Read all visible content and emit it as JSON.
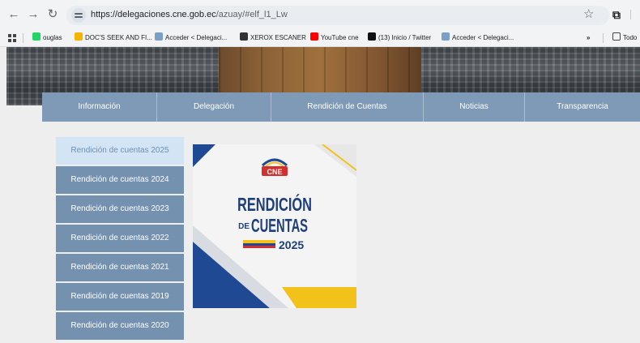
{
  "browser": {
    "url_host": "https://delegaciones.cne.gob.ec",
    "url_path": "/azuay/#elf_l1_Lw",
    "bookmarks": [
      {
        "label": "ouglas",
        "color": "#25d366"
      },
      {
        "label": "DOC'S SEEK AND FI...",
        "color": "#f4b400"
      },
      {
        "label": "Acceder < Delegaci...",
        "color": "#7aa0c8"
      },
      {
        "label": "XEROX ESCANER",
        "color": "#333333"
      },
      {
        "label": "YouTube cne",
        "color": "#ff0000"
      },
      {
        "label": "(13) Inicio / Twitter",
        "color": "#111111"
      },
      {
        "label": "Acceder < Delegaci...",
        "color": "#7aa0c8"
      }
    ],
    "overflow_label": "»",
    "all_bookmarks_label": "Todo"
  },
  "main_nav": [
    "Información",
    "Delegación",
    "Rendición de Cuentas",
    "Noticias",
    "Transparencia"
  ],
  "side_menu": [
    "Rendición de cuentas 2025",
    "Rendición de cuentas 2024",
    "Rendición de cuentas 2023",
    "Rendición de cuentas 2022",
    "Rendición de cuentas 2021",
    "Rendición de cuentas 2019",
    "Rendición de cuentas 2020"
  ],
  "banner": {
    "logo_text": "CNE",
    "line1": "RENDICIÓN",
    "line2_prefix": "DE",
    "line2": "CUENTAS",
    "year": "2025"
  },
  "colors": {
    "nav_bg": "#7e9ab7",
    "side_bg": "#7591b0",
    "side_active_bg": "#d3e5f5",
    "banner_blue": "#1f4a93",
    "banner_yellow": "#f2c21b"
  }
}
